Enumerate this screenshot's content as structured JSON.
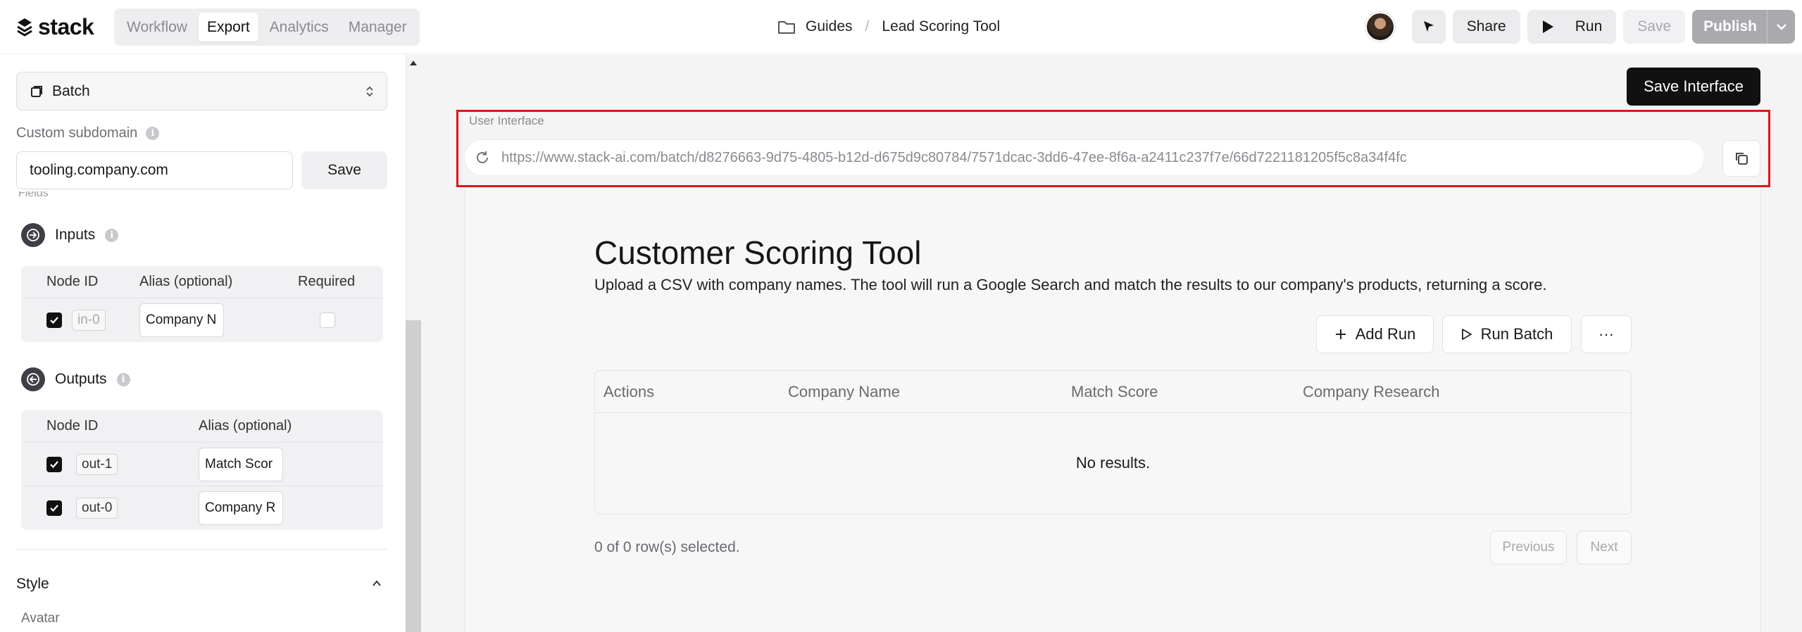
{
  "app": {
    "logo_text": "stack"
  },
  "nav": {
    "tabs": [
      {
        "label": "Workflow",
        "active": false
      },
      {
        "label": "Export",
        "active": true
      },
      {
        "label": "Analytics",
        "active": false
      },
      {
        "label": "Manager",
        "active": false
      }
    ]
  },
  "breadcrumb": {
    "folder": "Guides",
    "separator": "/",
    "page": "Lead Scoring Tool"
  },
  "toolbar": {
    "share_label": "Share",
    "run_label": "Run",
    "save_label": "Save",
    "publish_label": "Publish"
  },
  "sidebar": {
    "mode_select": "Batch",
    "custom_subdomain_label": "Custom subdomain",
    "subdomain_value": "tooling.company.com",
    "subdomain_save": "Save",
    "fields_peek": "Fields",
    "inputs": {
      "title": "Inputs",
      "headers": {
        "node_id": "Node ID",
        "alias": "Alias (optional)",
        "required": "Required"
      },
      "rows": [
        {
          "node_id": "in-0",
          "alias": "Company N",
          "checked": true,
          "required": false
        }
      ]
    },
    "outputs": {
      "title": "Outputs",
      "headers": {
        "node_id": "Node ID",
        "alias": "Alias (optional)"
      },
      "rows": [
        {
          "node_id": "out-1",
          "alias": "Match Scor",
          "checked": true
        },
        {
          "node_id": "out-0",
          "alias": "Company R",
          "checked": true
        }
      ]
    },
    "style_title": "Style",
    "avatar_label": "Avatar"
  },
  "main": {
    "save_interface_label": "Save Interface",
    "user_interface_label": "User Interface",
    "url": "https://www.stack-ai.com/batch/d8276663-9d75-4805-b12d-d675d9c80784/7571dcac-3dd6-47ee-8f6a-a2411c237f7e/66d7221181205f5c8a34f4fc",
    "app_title": "Customer Scoring Tool",
    "app_description": "Upload a CSV with company names. The tool will run a Google Search and match the results to our company's products, returning a score.",
    "add_run_label": "Add Run",
    "run_batch_label": "Run Batch",
    "more_label": "···",
    "table": {
      "columns": [
        "Actions",
        "Company Name",
        "Match Score",
        "Company Research"
      ],
      "empty_text": "No results."
    },
    "selection_status": "0 of 0 row(s) selected.",
    "previous_label": "Previous",
    "next_label": "Next"
  },
  "colors": {
    "highlight_border": "#e0141b",
    "primary_button": "#111111",
    "publish_button": "#a9a9ae"
  }
}
